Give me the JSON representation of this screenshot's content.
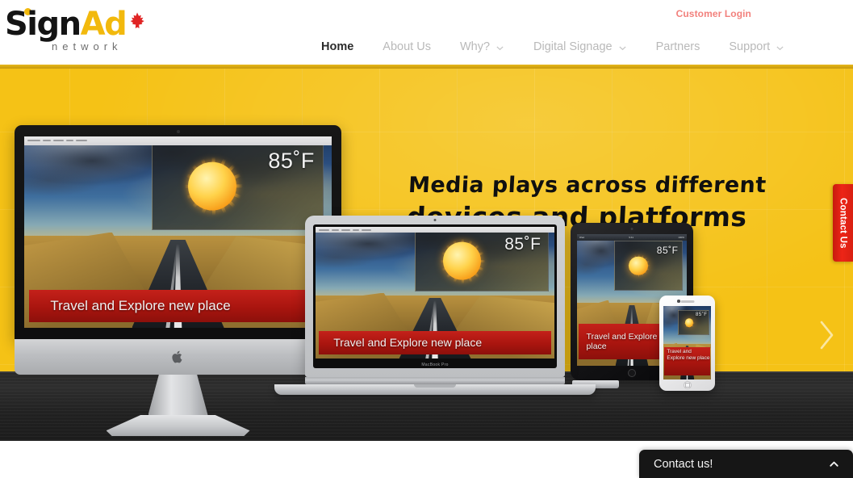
{
  "header": {
    "logo": {
      "part1": "Sign",
      "part2": "Ad",
      "subtitle": "network",
      "leaf_icon": "maple-leaf-icon"
    },
    "customer_login": "Customer Login",
    "nav": [
      {
        "label": "Home",
        "active": true,
        "caret": false
      },
      {
        "label": "About Us",
        "active": false,
        "caret": false
      },
      {
        "label": "Why?",
        "active": false,
        "caret": true
      },
      {
        "label": "Digital Signage",
        "active": false,
        "caret": true
      },
      {
        "label": "Partners",
        "active": false,
        "caret": false
      },
      {
        "label": "Support",
        "active": false,
        "caret": true
      }
    ]
  },
  "hero": {
    "headline_line1": "Media plays across different",
    "headline_line2": "devices and platforms",
    "background_color": "#f5c216",
    "next_arrow_icon": "chevron-right-icon",
    "devices": {
      "imac": {
        "name": "iMac",
        "temperature": "85˚F",
        "banner_text": "Travel and Explore new place",
        "brand_icon": "apple-logo-icon"
      },
      "macbook": {
        "name": "MacBook Pro",
        "label": "MacBook Pro",
        "temperature": "85˚F",
        "banner_text": "Travel and Explore new place"
      },
      "ipad": {
        "name": "iPad",
        "temperature": "85˚F",
        "banner_text": "Travel and Explore new place",
        "status_left": "iPad",
        "status_center": "9:41",
        "status_right": "100%"
      },
      "iphone": {
        "name": "iPhone",
        "temperature": "85˚F",
        "banner_text": "Travel and Explore new place"
      }
    }
  },
  "contact_tab": {
    "label": "Contact Us",
    "color": "#ed2517"
  },
  "chat_widget": {
    "title": "Contact us!",
    "chevron_icon": "chevron-up-icon"
  }
}
